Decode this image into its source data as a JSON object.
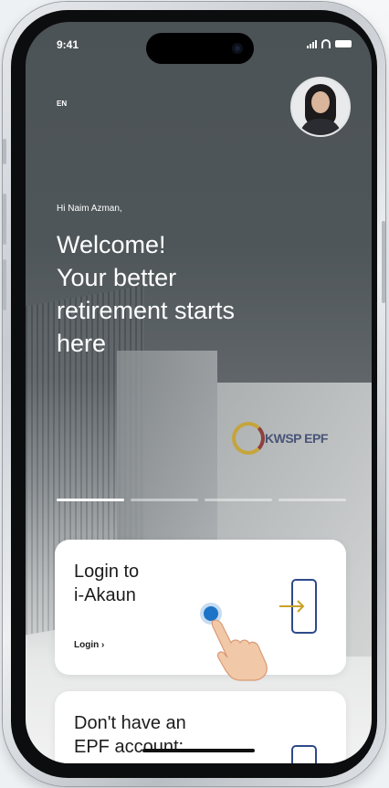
{
  "status_bar": {
    "time": "9:41"
  },
  "header": {
    "language": "EN"
  },
  "hero": {
    "greeting": "Hi Naim Azman,",
    "headline_lines": [
      "Welcome!",
      "Your better",
      "retirement starts",
      "here"
    ]
  },
  "background": {
    "building_sign": "KWSP EPF"
  },
  "carousel": {
    "pages": 4,
    "active_index": 0
  },
  "cards": [
    {
      "title_lines": [
        "Login to",
        "i-Akaun"
      ],
      "link": "Login ›",
      "icon": "login-door-arrow-icon"
    },
    {
      "title_lines": [
        "Don't have an",
        "EPF account:"
      ],
      "icon": "register-door-icon"
    }
  ],
  "colors": {
    "accent": "#c9a227",
    "icon_blue": "#2e4a8a",
    "tap_dot": "#1d73c7"
  }
}
